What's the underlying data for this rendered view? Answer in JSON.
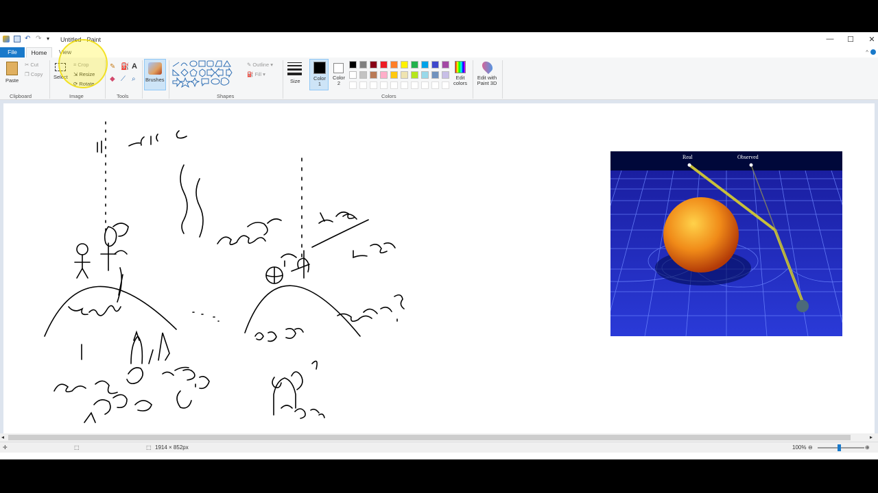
{
  "window": {
    "title": "Untitled - Paint"
  },
  "menu": {
    "file": "File",
    "home": "Home",
    "view": "View"
  },
  "clipboard": {
    "paste": "Paste",
    "cut": "Cut",
    "copy": "Copy",
    "label": "Clipboard"
  },
  "image": {
    "select": "Select",
    "crop": "Crop",
    "resize": "Resize",
    "rotate": "Rotate",
    "label": "Image"
  },
  "tools": {
    "label": "Tools"
  },
  "brushes": {
    "label": "Brushes"
  },
  "shapes": {
    "outline": "Outline",
    "fill": "Fill",
    "label": "Shapes"
  },
  "size": {
    "label": "Size"
  },
  "colors": {
    "color1": "Color 1",
    "color2": "Color 2",
    "label": "Colors",
    "edit": "Edit colors",
    "paint3d": "Edit with Paint 3D",
    "color1_value": "#000000",
    "color2_value": "#ffffff",
    "palette_row1": [
      "#000000",
      "#7f7f7f",
      "#880015",
      "#ed1c24",
      "#ff7f27",
      "#fff200",
      "#22b14c",
      "#00a2e8",
      "#3f48cc",
      "#a349a4"
    ],
    "palette_row2": [
      "#ffffff",
      "#c3c3c3",
      "#b97a57",
      "#ffaec9",
      "#ffc90e",
      "#efe4b0",
      "#b5e61d",
      "#99d9ea",
      "#7092be",
      "#c8bfe7"
    ]
  },
  "status": {
    "dimensions": "1914 × 852px",
    "zoom": "100%"
  },
  "canvas": {
    "image_labels": {
      "real": "Real",
      "observed": "Observed"
    }
  }
}
